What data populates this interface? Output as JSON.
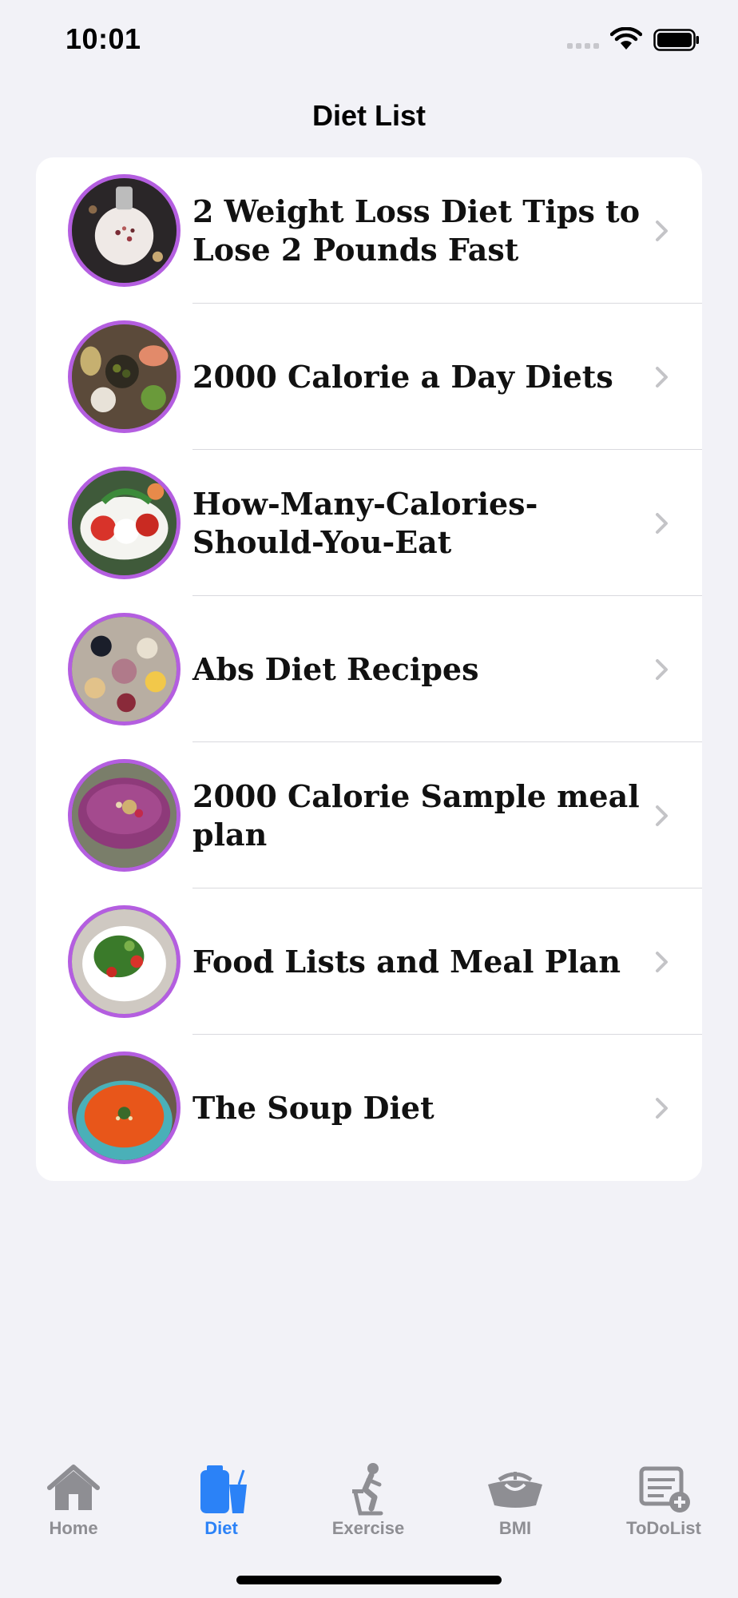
{
  "status_bar": {
    "time": "10:01"
  },
  "nav": {
    "title": "Diet List"
  },
  "diet_list": [
    {
      "title": "2 Weight Loss Diet Tips to Lose 2 Pounds Fast",
      "thumb": "yogurt-bowl"
    },
    {
      "title": "2000 Calorie a Day Diets",
      "thumb": "platter"
    },
    {
      "title": "How-Many-Calories-Should-You-Eat",
      "thumb": "caprese-salad"
    },
    {
      "title": "Abs Diet Recipes",
      "thumb": "brunch-table"
    },
    {
      "title": "2000 Calorie Sample meal plan",
      "thumb": "berry-smoothie-bowl"
    },
    {
      "title": "Food Lists and Meal Plan",
      "thumb": "green-salad"
    },
    {
      "title": "The Soup Diet",
      "thumb": "tomato-soup"
    }
  ],
  "tab_bar": {
    "tabs": [
      {
        "label": "Home",
        "icon": "house-icon",
        "active": false
      },
      {
        "label": "Diet",
        "icon": "diet-shake-icon",
        "active": true
      },
      {
        "label": "Exercise",
        "icon": "exercise-bike-icon",
        "active": false
      },
      {
        "label": "BMI",
        "icon": "scale-icon",
        "active": false
      },
      {
        "label": "ToDoList",
        "icon": "list-add-icon",
        "active": false
      }
    ]
  },
  "colors": {
    "accent": "#2b82f7",
    "inactive_tab": "#8e8e93",
    "thumb_border": "#b45ee0",
    "background": "#f2f2f7"
  }
}
